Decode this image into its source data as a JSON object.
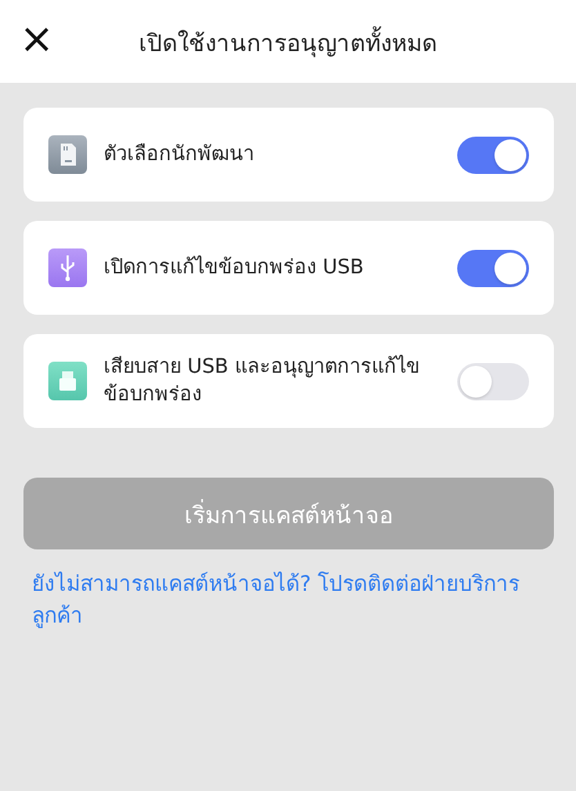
{
  "header": {
    "close": "×",
    "title": "เปิดใช้งานการอนุญาตทั้งหมด"
  },
  "settings": [
    {
      "kind": "developer",
      "label": "ตัวเลือกนักพัฒนา",
      "on": true
    },
    {
      "kind": "usb",
      "label": "เปิดการแก้ไขข้อบกพร่อง USB",
      "on": true
    },
    {
      "kind": "plug",
      "label": "เสียบสาย USB และอนุญาตการแก้ไขข้อบกพร่อง",
      "on": false
    }
  ],
  "start_button": {
    "label": "เริ่มการแคสต์หน้าจอ",
    "disabled": true
  },
  "help_link": "ยังไม่สามารถแคสต์หน้าจอได้? โปรดติดต่อฝ่ายบริการลูกค้า"
}
